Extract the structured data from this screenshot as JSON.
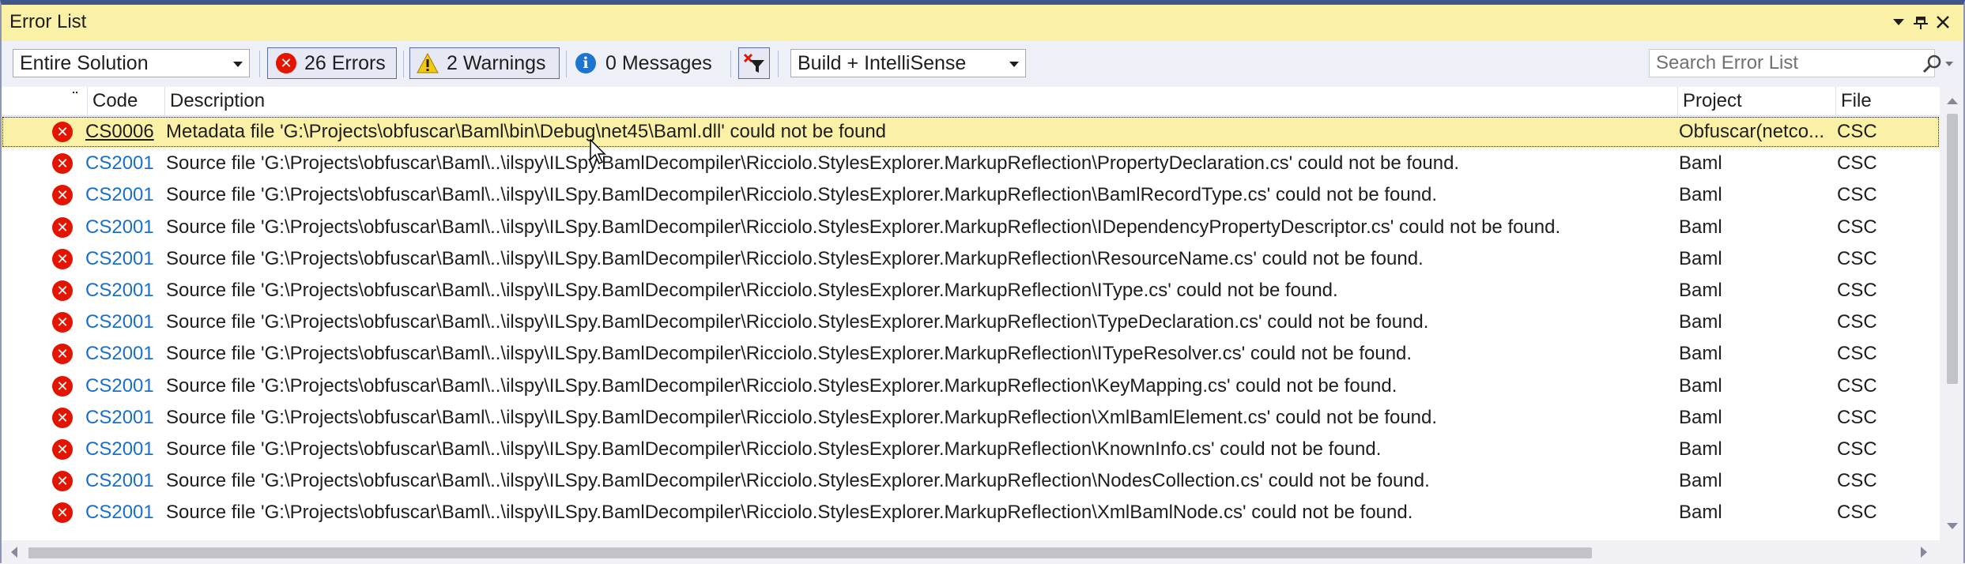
{
  "window": {
    "title": "Error List",
    "buttons": [
      "dropdown",
      "pin",
      "close"
    ]
  },
  "toolbar": {
    "scope": "Entire Solution",
    "errors_label": "26 Errors",
    "warnings_label": "2 Warnings",
    "messages_label": "0 Messages",
    "build_filter": "Build + IntelliSense",
    "search_placeholder": "Search Error List"
  },
  "columns": {
    "code": "Code",
    "description": "Description",
    "project": "Project",
    "file": "File"
  },
  "rows": [
    {
      "code": "CS0006",
      "description": "Metadata file 'G:\\Projects\\obfuscar\\Baml\\bin\\Debug\\net45\\Baml.dll' could not be found",
      "project": "Obfuscar(netco...",
      "file": "CSC"
    },
    {
      "code": "CS2001",
      "description": "Source file 'G:\\Projects\\obfuscar\\Baml\\..\\ilspy\\ILSpy.BamlDecompiler\\Ricciolo.StylesExplorer.MarkupReflection\\PropertyDeclaration.cs' could not be found.",
      "project": "Baml",
      "file": "CSC"
    },
    {
      "code": "CS2001",
      "description": "Source file 'G:\\Projects\\obfuscar\\Baml\\..\\ilspy\\ILSpy.BamlDecompiler\\Ricciolo.StylesExplorer.MarkupReflection\\BamlRecordType.cs' could not be found.",
      "project": "Baml",
      "file": "CSC"
    },
    {
      "code": "CS2001",
      "description": "Source file 'G:\\Projects\\obfuscar\\Baml\\..\\ilspy\\ILSpy.BamlDecompiler\\Ricciolo.StylesExplorer.MarkupReflection\\IDependencyPropertyDescriptor.cs' could not be found.",
      "project": "Baml",
      "file": "CSC"
    },
    {
      "code": "CS2001",
      "description": "Source file 'G:\\Projects\\obfuscar\\Baml\\..\\ilspy\\ILSpy.BamlDecompiler\\Ricciolo.StylesExplorer.MarkupReflection\\ResourceName.cs' could not be found.",
      "project": "Baml",
      "file": "CSC"
    },
    {
      "code": "CS2001",
      "description": "Source file 'G:\\Projects\\obfuscar\\Baml\\..\\ilspy\\ILSpy.BamlDecompiler\\Ricciolo.StylesExplorer.MarkupReflection\\IType.cs' could not be found.",
      "project": "Baml",
      "file": "CSC"
    },
    {
      "code": "CS2001",
      "description": "Source file 'G:\\Projects\\obfuscar\\Baml\\..\\ilspy\\ILSpy.BamlDecompiler\\Ricciolo.StylesExplorer.MarkupReflection\\TypeDeclaration.cs' could not be found.",
      "project": "Baml",
      "file": "CSC"
    },
    {
      "code": "CS2001",
      "description": "Source file 'G:\\Projects\\obfuscar\\Baml\\..\\ilspy\\ILSpy.BamlDecompiler\\Ricciolo.StylesExplorer.MarkupReflection\\ITypeResolver.cs' could not be found.",
      "project": "Baml",
      "file": "CSC"
    },
    {
      "code": "CS2001",
      "description": "Source file 'G:\\Projects\\obfuscar\\Baml\\..\\ilspy\\ILSpy.BamlDecompiler\\Ricciolo.StylesExplorer.MarkupReflection\\KeyMapping.cs' could not be found.",
      "project": "Baml",
      "file": "CSC"
    },
    {
      "code": "CS2001",
      "description": "Source file 'G:\\Projects\\obfuscar\\Baml\\..\\ilspy\\ILSpy.BamlDecompiler\\Ricciolo.StylesExplorer.MarkupReflection\\XmlBamlElement.cs' could not be found.",
      "project": "Baml",
      "file": "CSC"
    },
    {
      "code": "CS2001",
      "description": "Source file 'G:\\Projects\\obfuscar\\Baml\\..\\ilspy\\ILSpy.BamlDecompiler\\Ricciolo.StylesExplorer.MarkupReflection\\KnownInfo.cs' could not be found.",
      "project": "Baml",
      "file": "CSC"
    },
    {
      "code": "CS2001",
      "description": "Source file 'G:\\Projects\\obfuscar\\Baml\\..\\ilspy\\ILSpy.BamlDecompiler\\Ricciolo.StylesExplorer.MarkupReflection\\NodesCollection.cs' could not be found.",
      "project": "Baml",
      "file": "CSC"
    },
    {
      "code": "CS2001",
      "description": "Source file 'G:\\Projects\\obfuscar\\Baml\\..\\ilspy\\ILSpy.BamlDecompiler\\Ricciolo.StylesExplorer.MarkupReflection\\XmlBamlNode.cs' could not be found.",
      "project": "Baml",
      "file": "CSC"
    }
  ],
  "selected_row": 0,
  "colors": {
    "title_bar": "#fbf1a6",
    "selected_row": "#fbf1a6",
    "error_red": "#e51400",
    "link_blue": "#1a6fc9",
    "frame_blue": "#40568d"
  },
  "icons": {
    "row_icon": "error-icon",
    "errors_filter": "error-icon",
    "warnings_filter": "warning-icon",
    "messages_filter": "info-icon",
    "clear_filter": "clear-filter-icon",
    "search": "search-icon"
  }
}
